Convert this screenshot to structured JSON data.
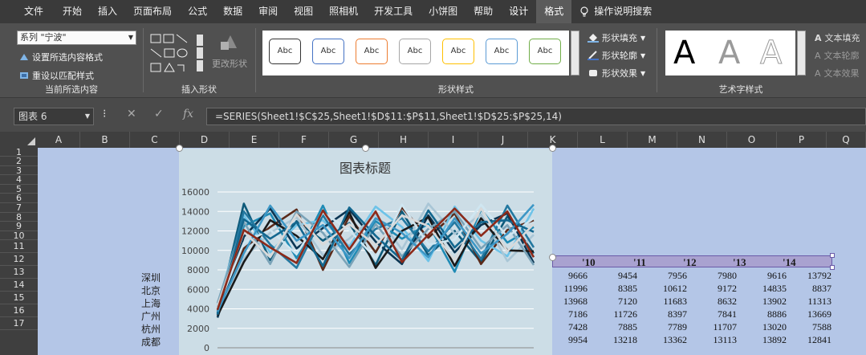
{
  "ribbon_tabs": [
    {
      "label": "文件"
    },
    {
      "label": "开始"
    },
    {
      "label": "插入"
    },
    {
      "label": "页面布局"
    },
    {
      "label": "公式"
    },
    {
      "label": "数据"
    },
    {
      "label": "审阅"
    },
    {
      "label": "视图"
    },
    {
      "label": "照相机"
    },
    {
      "label": "开发工具"
    },
    {
      "label": "小饼图"
    },
    {
      "label": "帮助"
    },
    {
      "label": "设计"
    },
    {
      "label": "格式"
    }
  ],
  "search_label": "操作说明搜索",
  "ribbon": {
    "selection_group": {
      "combo_value": "系列 \"宁波\"",
      "format_selection": "设置所选内容格式",
      "reset_style": "重设以匹配样式",
      "label": "当前所选内容"
    },
    "insert_shapes_group": {
      "change_shape": "更改形状",
      "label": "插入形状"
    },
    "shape_styles_group": {
      "swatches": [
        {
          "text": "Abc",
          "border": "#333333"
        },
        {
          "text": "Abc",
          "border": "#4472c4"
        },
        {
          "text": "Abc",
          "border": "#ed7d31"
        },
        {
          "text": "Abc",
          "border": "#a5a5a5"
        },
        {
          "text": "Abc",
          "border": "#ffc000"
        },
        {
          "text": "Abc",
          "border": "#5b9bd5"
        },
        {
          "text": "Abc",
          "border": "#70ad47"
        }
      ],
      "fill": "形状填充",
      "outline": "形状轮廓",
      "effects": "形状效果",
      "label": "形状样式"
    },
    "wordart_group": {
      "letters": [
        "A",
        "A",
        "A"
      ],
      "text_fill": "文本填充",
      "text_outline": "文本轮廓",
      "text_effects": "文本效果",
      "label": "艺术字样式"
    }
  },
  "formula_bar": {
    "name_box": "图表 6",
    "fx": "fx",
    "formula": "=SERIES(Sheet1!$C$25,Sheet1!$D$11:$P$11,Sheet1!$D$25:$P$25,14)"
  },
  "sheet": {
    "columns": [
      "A",
      "B",
      "C",
      "D",
      "E",
      "F",
      "G",
      "H",
      "I",
      "J",
      "K",
      "L",
      "M",
      "N",
      "O",
      "P",
      "Q"
    ],
    "rows": [
      "1",
      "2",
      "3",
      "4",
      "5",
      "6",
      "7",
      "8",
      "9",
      "10",
      "11",
      "12",
      "13",
      "14",
      "15",
      "16",
      "17"
    ],
    "cities": [
      "深圳",
      "北京",
      "上海",
      "广州",
      "杭州",
      "成都"
    ],
    "year_labels": [
      "'10",
      "'11",
      "'12",
      "'13",
      "'14"
    ],
    "table_rows": [
      [
        "9666",
        "9454",
        "7956",
        "7980",
        "9616",
        "13792"
      ],
      [
        "11996",
        "8385",
        "10612",
        "9172",
        "14835",
        "8837"
      ],
      [
        "13968",
        "7120",
        "11683",
        "8632",
        "13902",
        "11313"
      ],
      [
        "7186",
        "11726",
        "8397",
        "7841",
        "8886",
        "13669"
      ],
      [
        "7428",
        "7885",
        "7789",
        "11707",
        "13020",
        "7588"
      ],
      [
        "9954",
        "13218",
        "13362",
        "13113",
        "13892",
        "12841"
      ]
    ]
  },
  "chart_data": {
    "type": "line",
    "title": "图表标题",
    "ylim": [
      0,
      16000
    ],
    "yticks": [
      "0",
      "2000",
      "4000",
      "6000",
      "8000",
      "10000",
      "12000",
      "14000",
      "16000"
    ],
    "grid": true,
    "x": [
      0,
      1,
      2,
      3,
      4,
      5,
      6,
      7,
      8,
      9,
      10,
      11,
      12
    ],
    "series": [
      {
        "color": "#0e5a7a",
        "values": [
          3500,
          14800,
          9000,
          13000,
          11000,
          12800,
          8500,
          14000,
          9500,
          12000,
          8800,
          13500,
          9700
        ]
      },
      {
        "color": "#1f8bb5",
        "values": [
          4200,
          12500,
          13800,
          9200,
          14600,
          8700,
          13000,
          11200,
          12700,
          7800,
          14200,
          10800,
          12400
        ]
      },
      {
        "color": "#5a2a1a",
        "values": [
          3800,
          10200,
          12400,
          14200,
          8000,
          13500,
          9800,
          14400,
          11300,
          13800,
          8600,
          12100,
          13100
        ]
      },
      {
        "color": "#6ec3e8",
        "values": [
          4400,
          13600,
          9800,
          12600,
          13100,
          10400,
          14500,
          12400,
          8900,
          14500,
          11000,
          9400,
          14300
        ]
      },
      {
        "color": "#0b3552",
        "values": [
          3100,
          11400,
          14300,
          10200,
          12300,
          14200,
          10900,
          8600,
          13600,
          9800,
          12600,
          13800,
          8700
        ]
      },
      {
        "color": "#a9c6d6",
        "values": [
          4000,
          9200,
          11800,
          13400,
          9500,
          11200,
          13700,
          10100,
          14800,
          11700,
          13700,
          8900,
          11600
        ]
      },
      {
        "color": "#2378a0",
        "values": [
          3600,
          14000,
          10600,
          8200,
          13600,
          9600,
          12200,
          13300,
          9900,
          12900,
          9100,
          14600,
          10300
        ]
      },
      {
        "color": "#1a1a1a",
        "values": [
          3300,
          8800,
          13100,
          11500,
          9100,
          13900,
          8200,
          12000,
          13400,
          8400,
          13300,
          10000,
          9900
        ]
      },
      {
        "color": "#7aa3b8",
        "values": [
          4600,
          12900,
          8600,
          14000,
          11800,
          8300,
          12700,
          9400,
          12200,
          14000,
          10200,
          12600,
          8500
        ]
      },
      {
        "color": "#cfe6f1",
        "values": [
          4100,
          10800,
          12100,
          9600,
          13900,
          12100,
          9200,
          14700,
          10600,
          11100,
          14700,
          11400,
          13300
        ]
      },
      {
        "color": "#13678f",
        "values": [
          3400,
          13200,
          11200,
          12900,
          8400,
          14400,
          11500,
          9000,
          14100,
          10300,
          12900,
          13100,
          11900
        ]
      },
      {
        "color": "#3d97c6",
        "values": [
          3700,
          9700,
          14600,
          11000,
          12600,
          9200,
          13300,
          11800,
          9300,
          13300,
          9700,
          11700,
          14700
        ]
      },
      {
        "color": "#d9d9d9",
        "values": [
          4300,
          11900,
          9300,
          13700,
          10600,
          12700,
          10500,
          13600,
          12500,
          9000,
          14300,
          9900,
          12700
        ]
      },
      {
        "color": "#8c2a1a",
        "values": [
          3900,
          12100,
          10300,
          8700,
          14100,
          10100,
          14000,
          8800,
          11600,
          14300,
          11500,
          14000,
          9300
        ]
      }
    ]
  }
}
